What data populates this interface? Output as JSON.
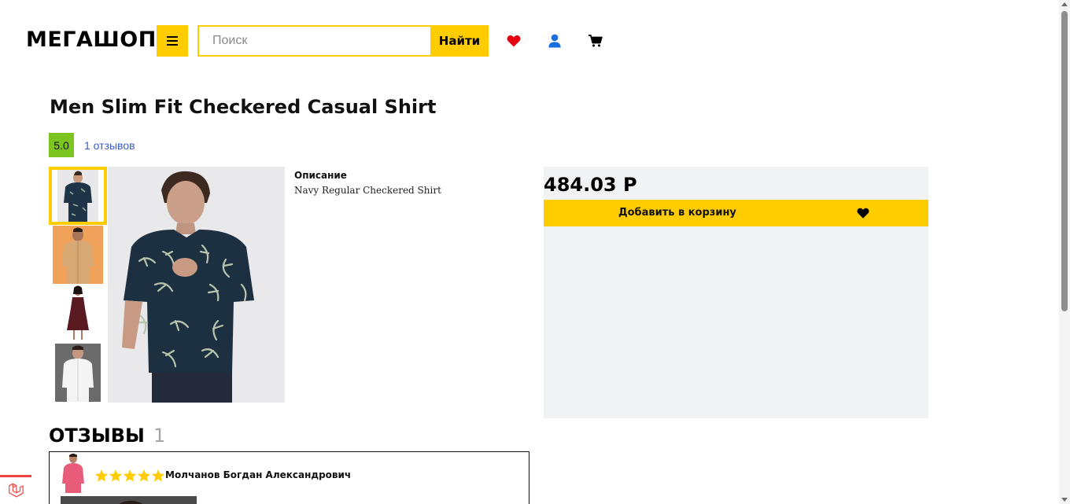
{
  "header": {
    "logo": "МЕГАШОП",
    "search_placeholder": "Поиск",
    "search_button": "Найти",
    "icons": [
      "menu-icon",
      "heart-icon",
      "user-icon",
      "cart-icon"
    ],
    "colors": {
      "accent": "#ffcc00",
      "heart": "#e60012",
      "user": "#1a6fe0"
    }
  },
  "product": {
    "title": "Men Slim Fit Checkered Casual Shirt",
    "rating": "5.0",
    "reviews_link": "1 отзывов",
    "description_title": "Описание",
    "description": "Navy Regular Checkered Shirt",
    "price": "484.03 Р",
    "add_to_cart": "Добавить в корзину",
    "rating_color": "#7cc520",
    "thumbnails": [
      "navy-shirt",
      "beige-shirt",
      "burgundy-dress",
      "white-shirt"
    ],
    "selected_thumbnail": 1
  },
  "reviews": {
    "title": "ОТЗЫВЫ",
    "count": "1",
    "items": [
      {
        "author": "Молчанов Богдан Александрович",
        "stars": 5
      }
    ]
  }
}
